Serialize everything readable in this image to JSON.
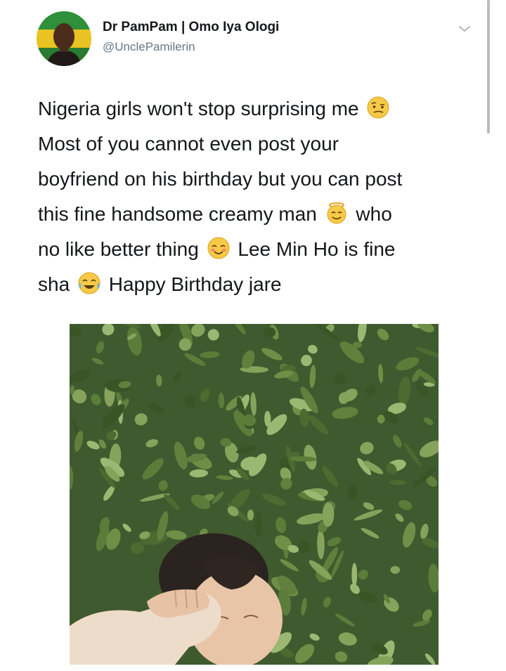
{
  "tweet": {
    "author": {
      "display_name": "Dr PamPam | Omo Iya Ologi",
      "handle": "@UnclePamilerin",
      "avatar_icon": "profile-avatar"
    },
    "menu_icon": "chevron-down-icon",
    "text_lines": [
      {
        "parts": [
          "Nigeria girls won't stop surprising me",
          ""
        ]
      },
      {
        "parts": [
          "Most of you cannot even post your"
        ]
      },
      {
        "parts": [
          "boyfriend on his birthday but you can post"
        ]
      },
      {
        "parts": [
          "this fine handsome creamy man",
          "who"
        ]
      },
      {
        "parts": [
          "no like better thing",
          "Lee Min Ho is fine"
        ]
      },
      {
        "parts": [
          "sha",
          "Happy Birthday jare"
        ]
      }
    ],
    "emojis": [
      "raised-eyebrow-emoji",
      "angel-emoji",
      "smiling-blush-emoji",
      "tears-of-joy-emoji"
    ],
    "media": {
      "type": "photo",
      "subject": "person-lying-in-leaves"
    }
  },
  "colors": {
    "text": "#14171a",
    "secondary": "#657786",
    "emoji_yellow": "#f7c948",
    "foliage_dark": "#3f5a2e"
  }
}
